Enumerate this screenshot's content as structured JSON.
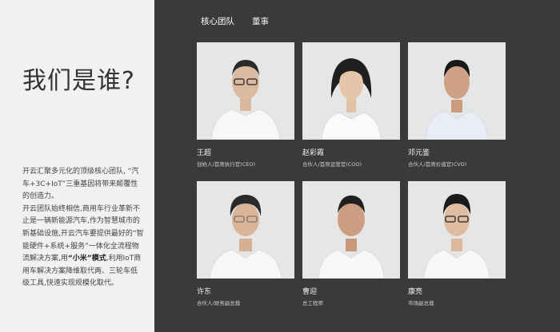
{
  "left": {
    "title": "我们是谁?",
    "intro": {
      "p1": "开云汇聚多元化的顶级核心团队, “汽车+3C+IoT”三重基因将带来颠覆性的创造力。",
      "p2a": "开云团队始终相信,商用车行业革新不止是一辆新能源汽车,作为智慧城市的新基础设施,开云汽车要提供最好的“智能硬件+系统+服务”一体化全流程物流解决方案,用",
      "p2bold": "“小米”模式",
      "p2b": ",利用IoT商用车解决方案降维取代两、三轮车低级工具,快速实现规模化取代。"
    }
  },
  "tabs": [
    {
      "label": "核心团队",
      "active": true
    },
    {
      "label": "董事",
      "active": false
    }
  ],
  "team": [
    {
      "name": "王超",
      "role": "创始人/首席执行官(CEO)"
    },
    {
      "name": "赵彩霞",
      "role": "合伙人/首席运营官(COO)"
    },
    {
      "name": "邓元鉴",
      "role": "合伙人/首席价值官(CVO)"
    },
    {
      "name": "许东",
      "role": "合伙人/财务副总裁"
    },
    {
      "name": "曹迎",
      "role": "总工程师"
    },
    {
      "name": "康亮",
      "role": "市场副总裁"
    }
  ],
  "colors": {
    "left_bg": "#f1f1f1",
    "right_bg": "#3a3a3a",
    "photo_bg": "#e8e8e8"
  }
}
